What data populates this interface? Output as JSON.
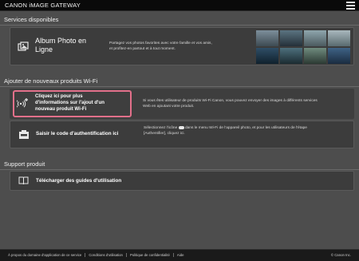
{
  "header": {
    "brand": "CANON iMAGE GATEWAY",
    "menu_icon": "hamburger-menu-icon"
  },
  "services": {
    "title": "Services disponibles",
    "album": {
      "label_line1": "Album Photo en",
      "label_line2": "Ligne",
      "desc_line1": "Partagez vos photos favorites avec votre famille et vos amis,",
      "desc_line2": "et profitez-en partout et à tout moment.",
      "icon": "photo-album-icon"
    }
  },
  "add_products": {
    "title": "Ajouter de nouveaux produits Wi-Fi",
    "new_product": {
      "label_line1": "Cliquez ici pour plus",
      "label_line2": "d'informations sur l'ajout d'un",
      "label_line3": "nouveau produit Wi-Fi",
      "desc_line1": "Si vous êtes utilisateur de produits Wi-Fi Canon, vous pouvez envoyer des images à différents services",
      "desc_line2": "Web en ajoutant votre produit.",
      "icon": "wifi-plus-icon"
    },
    "auth_code": {
      "label": "Saisir le code d'authentification ici",
      "desc_line1_a": "Sélectionnez l'icône",
      "desc_line1_b": "dans le menu Wi-Fi de l'appareil photo, et pour les utilisateurs de l'étape",
      "desc_line2": "[Authentifier], cliquez ici.",
      "icon": "camera-key-icon"
    }
  },
  "support": {
    "title": "Support produit",
    "guides": {
      "label": "Télécharger des guides d'utilisation",
      "icon": "book-icon"
    }
  },
  "footer": {
    "links": [
      "À propos du domaine d'application de ce service",
      "Conditions d'utilisation",
      "Politique de confidentialité",
      "Aide"
    ],
    "copyright": "© Canon Inc."
  },
  "colors": {
    "background": "#4d4d4d",
    "card": "#3c3c3c",
    "highlight_border": "#e2708a"
  }
}
